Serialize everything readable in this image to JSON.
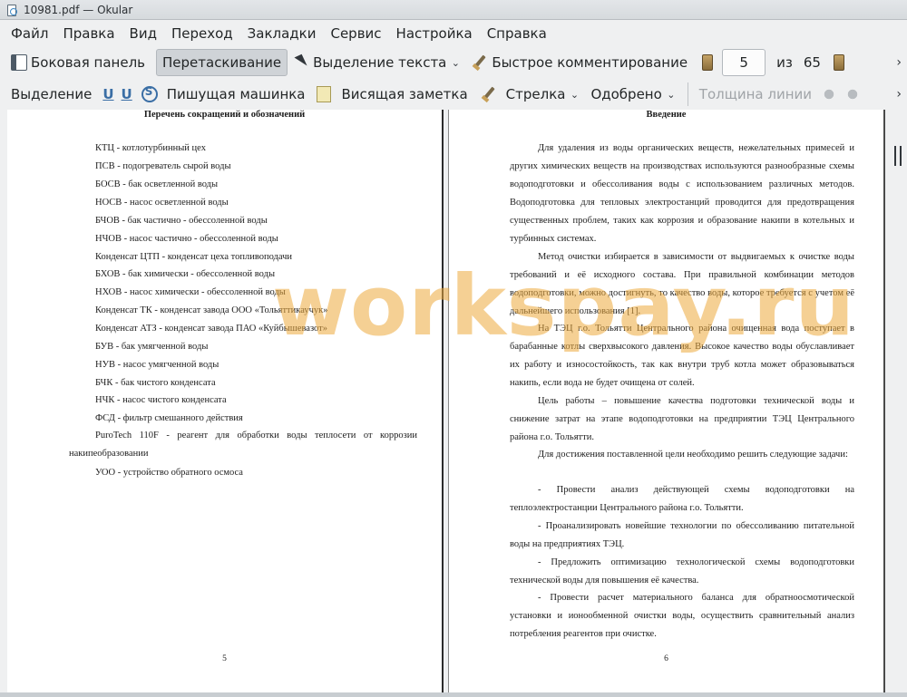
{
  "window": {
    "title": "10981.pdf  — Okular"
  },
  "menu": [
    "Файл",
    "Правка",
    "Вид",
    "Переход",
    "Закладки",
    "Сервис",
    "Настройка",
    "Справка"
  ],
  "toolbar1": {
    "sidebar_label": "Боковая панель",
    "drag_label": "Перетаскивание",
    "text_select_label": "Выделение текста",
    "quick_comment_label": "Быстрое комментирование",
    "page_current": "5",
    "page_of": "из",
    "page_total": "65"
  },
  "toolbar2": {
    "highlight_label": "Выделение",
    "typewriter_label": "Пишущая машинка",
    "inline_note_label": "Висящая заметка",
    "arrow_label": "Стрелка",
    "approved_label": "Одобрено",
    "line_width_label": "Толщина линии"
  },
  "left_page": {
    "title": "Перечень сокращений и обозначений",
    "items": [
      "КТЦ - котлотурбинный цех",
      "ПСВ - подогреватель сырой воды",
      "БОСВ - бак осветленной воды",
      "НОСВ - насос осветленной воды",
      "БЧОВ - бак частично - обессоленной воды",
      "НЧОВ - насос частично - обессоленной воды",
      "Конденсат ЦТП - конденсат цеха топливоподачи",
      "БХОВ - бак химически - обессоленной воды",
      "НХОВ - насос химически - обессоленной воды",
      "Конденсат ТК - конденсат завода ООО «Тольяттикаучук»",
      "Конденсат АТЗ - конденсат завода ПАО «Куйбышевазот»",
      "БУВ - бак умягченной воды",
      "НУВ - насос умягченной воды",
      "БЧК - бак чистого конденсата",
      "НЧК - насос чистого конденсата",
      "ФСД - фильтр смешанного действия"
    ],
    "puro_item": "PuroTech 110F - реагент для обработки воды теплосети от коррозии накипеобразовании",
    "last_item": "УОО - устройство обратного осмоса",
    "page_number": "5"
  },
  "right_page": {
    "title": "Введение",
    "paragraphs": [
      "Для удаления из воды органических веществ, нежелательных примесей и других химических веществ на производствах используются разнообразные схемы водоподготовки и обессоливания воды с использованием различных методов. Водоподготовка для тепловых электростанций проводится для предотвращения существенных проблем, таких как коррозия и образование накипи в котельных и турбинных системах.",
      "Метод очистки избирается в зависимости от выдвигаемых к очистке воды требований и её исходного состава. При правильной комбинации методов водоподготовки, можно достигнуть, то качество воды, которое требуется с учетом её дальнейшего использования [1].",
      "На ТЭЦ г.о. Тольятти Центрального района очищенная вода поступает в барабанные котлы сверхвысокого давления. Высокое качество воды обуславливает их работу и износостойкость, так как внутри труб котла может образовываться накипь, если вода не будет очищена от солей.",
      "Цель работы – повышение качества подготовки технической воды и снижение затрат на этапе водоподготовки на предприятии ТЭЦ Центрального района г.о. Тольятти.",
      "Для достижения поставленной цели необходимо решить следующие задачи:",
      "- Провести анализ действующей схемы водоподготовки на теплоэлектростанции Центрального района г.о. Тольятти.",
      "- Проанализировать новейшие технологии по обессоливанию питательной воды на предприятиях ТЭЦ.",
      "- Предложить оптимизацию технологической схемы водоподготовки технической воды для повышения её качества.",
      "- Провести расчет материального баланса для обратноосмотической установки и ионообменной очистки воды, осуществить сравнительный анализ потребления реагентов при очистке."
    ],
    "page_number": "6"
  },
  "watermark": "workspay.ru",
  "colors": {
    "watermark": "#ecaa3c",
    "window_bg": "#eff0f1",
    "active_tool": "#cfd3d7"
  }
}
